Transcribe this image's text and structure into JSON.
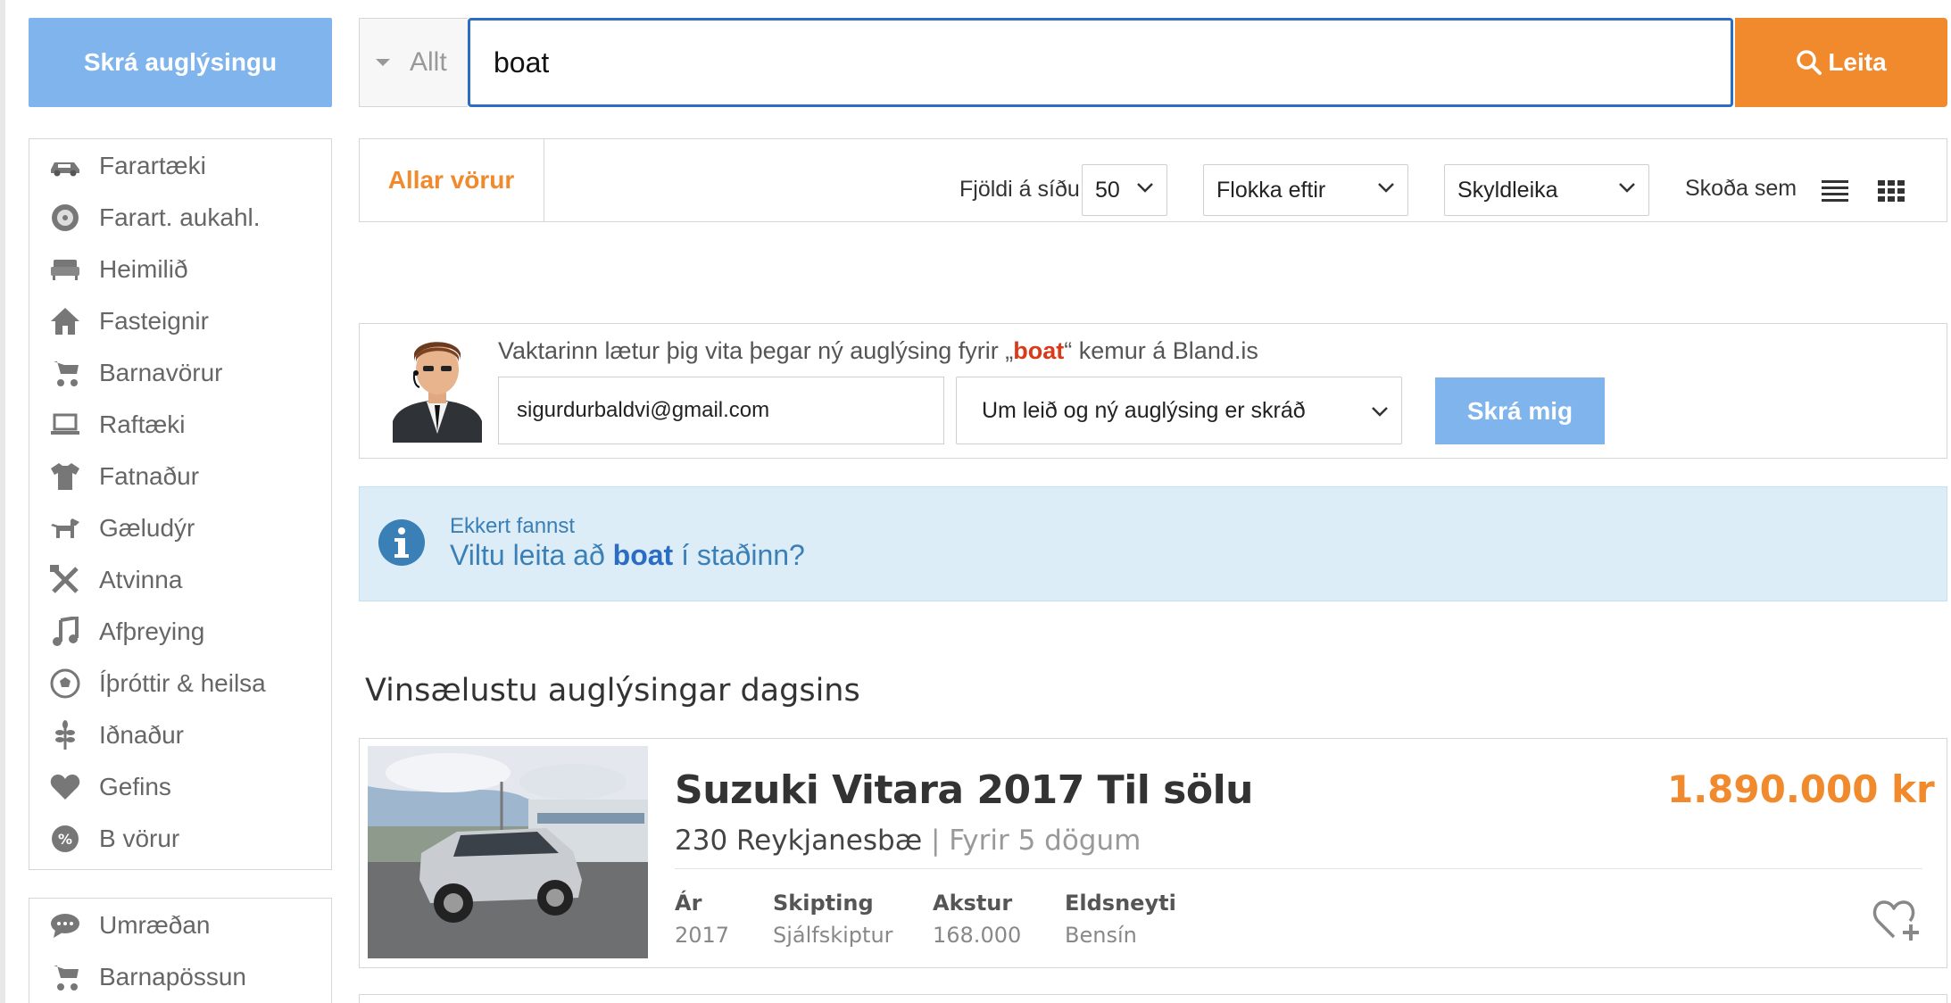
{
  "register_button": "Skrá auglýsingu",
  "search": {
    "category": "Allt",
    "query": "boat",
    "button_label": "Leita"
  },
  "sidebar": {
    "items": [
      {
        "label": "Farartæki",
        "icon": "car-icon"
      },
      {
        "label": "Farart. aukahl.",
        "icon": "wheel-icon"
      },
      {
        "label": "Heimilið",
        "icon": "sofa-icon"
      },
      {
        "label": "Fasteignir",
        "icon": "house-icon"
      },
      {
        "label": "Barnavörur",
        "icon": "stroller-icon"
      },
      {
        "label": "Raftæki",
        "icon": "laptop-icon"
      },
      {
        "label": "Fatnaður",
        "icon": "shirt-icon"
      },
      {
        "label": "Gæludýr",
        "icon": "dog-icon"
      },
      {
        "label": "Atvinna",
        "icon": "tools-icon"
      },
      {
        "label": "Afþreying",
        "icon": "music-icon"
      },
      {
        "label": "Íþróttir & heilsa",
        "icon": "soccer-ball-icon"
      },
      {
        "label": "Iðnaður",
        "icon": "wheat-icon"
      },
      {
        "label": "Gefins",
        "icon": "heart-icon"
      },
      {
        "label": "B vörur",
        "icon": "percent-badge-icon"
      }
    ],
    "secondary": [
      {
        "label": "Umræðan",
        "icon": "chat-icon"
      },
      {
        "label": "Barnapössun",
        "icon": "stroller-icon"
      }
    ]
  },
  "toolbar": {
    "all_products": "Allar vörur",
    "per_page_label": "Fjöldi á síðu",
    "per_page_value": "50",
    "sort_by": "Flokka eftir",
    "relevance": "Skyldleika",
    "view_as": "Skoða sem"
  },
  "watcher": {
    "text_before": "Vaktarinn lætur þig vita þegar ný auglýsing fyrir „",
    "keyword": "boat",
    "text_after": "“ kemur á Bland.is",
    "email": "sigurdurbaldvi@gmail.com",
    "frequency": "Um leið og ný auglýsing er skráð",
    "button": "Skrá mig"
  },
  "info": {
    "title": "Ekkert fannst",
    "suggestion_before": "Viltu leita að ",
    "suggestion_keyword": "boat",
    "suggestion_after": " í staðinn?"
  },
  "section_title": "Vinsælustu auglýsingar dagsins",
  "listing": {
    "title": "Suzuki Vitara 2017 Til sölu",
    "price": "1.890.000 kr",
    "location": "230 Reykjanesbæ",
    "separator": " | ",
    "age": "Fyrir 5 dögum",
    "attributes": [
      {
        "label": "Ár",
        "value": "2017"
      },
      {
        "label": "Skipting",
        "value": "Sjálfskiptur"
      },
      {
        "label": "Akstur",
        "value": "168.000"
      },
      {
        "label": "Eldsneyti",
        "value": "Bensín"
      }
    ]
  },
  "colors": {
    "accent_orange": "#f08a2c",
    "primary_blue": "#7fb4ec",
    "focus_blue": "#2b6cc4",
    "info_bg": "#dcedf8"
  }
}
